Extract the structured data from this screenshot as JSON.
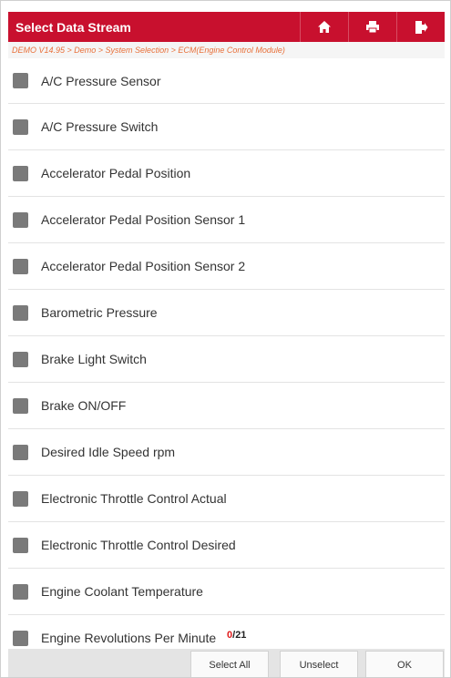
{
  "header": {
    "title": "Select Data Stream",
    "buttons": [
      {
        "name": "home-button",
        "icon": "home-icon"
      },
      {
        "name": "print-button",
        "icon": "printer-icon"
      },
      {
        "name": "exit-button",
        "icon": "exit-icon"
      }
    ],
    "accent_color": "#c8102e"
  },
  "breadcrumb": "DEMO V14.95 > Demo > System Selection > ECM(Engine Control Module)",
  "items": [
    {
      "label": "A/C Pressure Sensor",
      "checked": false
    },
    {
      "label": "A/C Pressure Switch",
      "checked": false
    },
    {
      "label": "Accelerator Pedal Position",
      "checked": false
    },
    {
      "label": "Accelerator Pedal Position Sensor 1",
      "checked": false
    },
    {
      "label": "Accelerator Pedal Position Sensor 2",
      "checked": false
    },
    {
      "label": "Barometric Pressure",
      "checked": false
    },
    {
      "label": "Brake Light Switch",
      "checked": false
    },
    {
      "label": "Brake ON/OFF",
      "checked": false
    },
    {
      "label": "Desired Idle Speed rpm",
      "checked": false
    },
    {
      "label": "Electronic Throttle Control Actual",
      "checked": false
    },
    {
      "label": "Electronic Throttle Control Desired",
      "checked": false
    },
    {
      "label": "Engine Coolant Temperature",
      "checked": false
    },
    {
      "label": "Engine Revolutions Per Minute",
      "checked": false
    }
  ],
  "pagination": {
    "current": "0",
    "separator": "/",
    "total": "21"
  },
  "footer": {
    "select_all": "Select All",
    "unselect": "Unselect",
    "ok": "OK"
  }
}
